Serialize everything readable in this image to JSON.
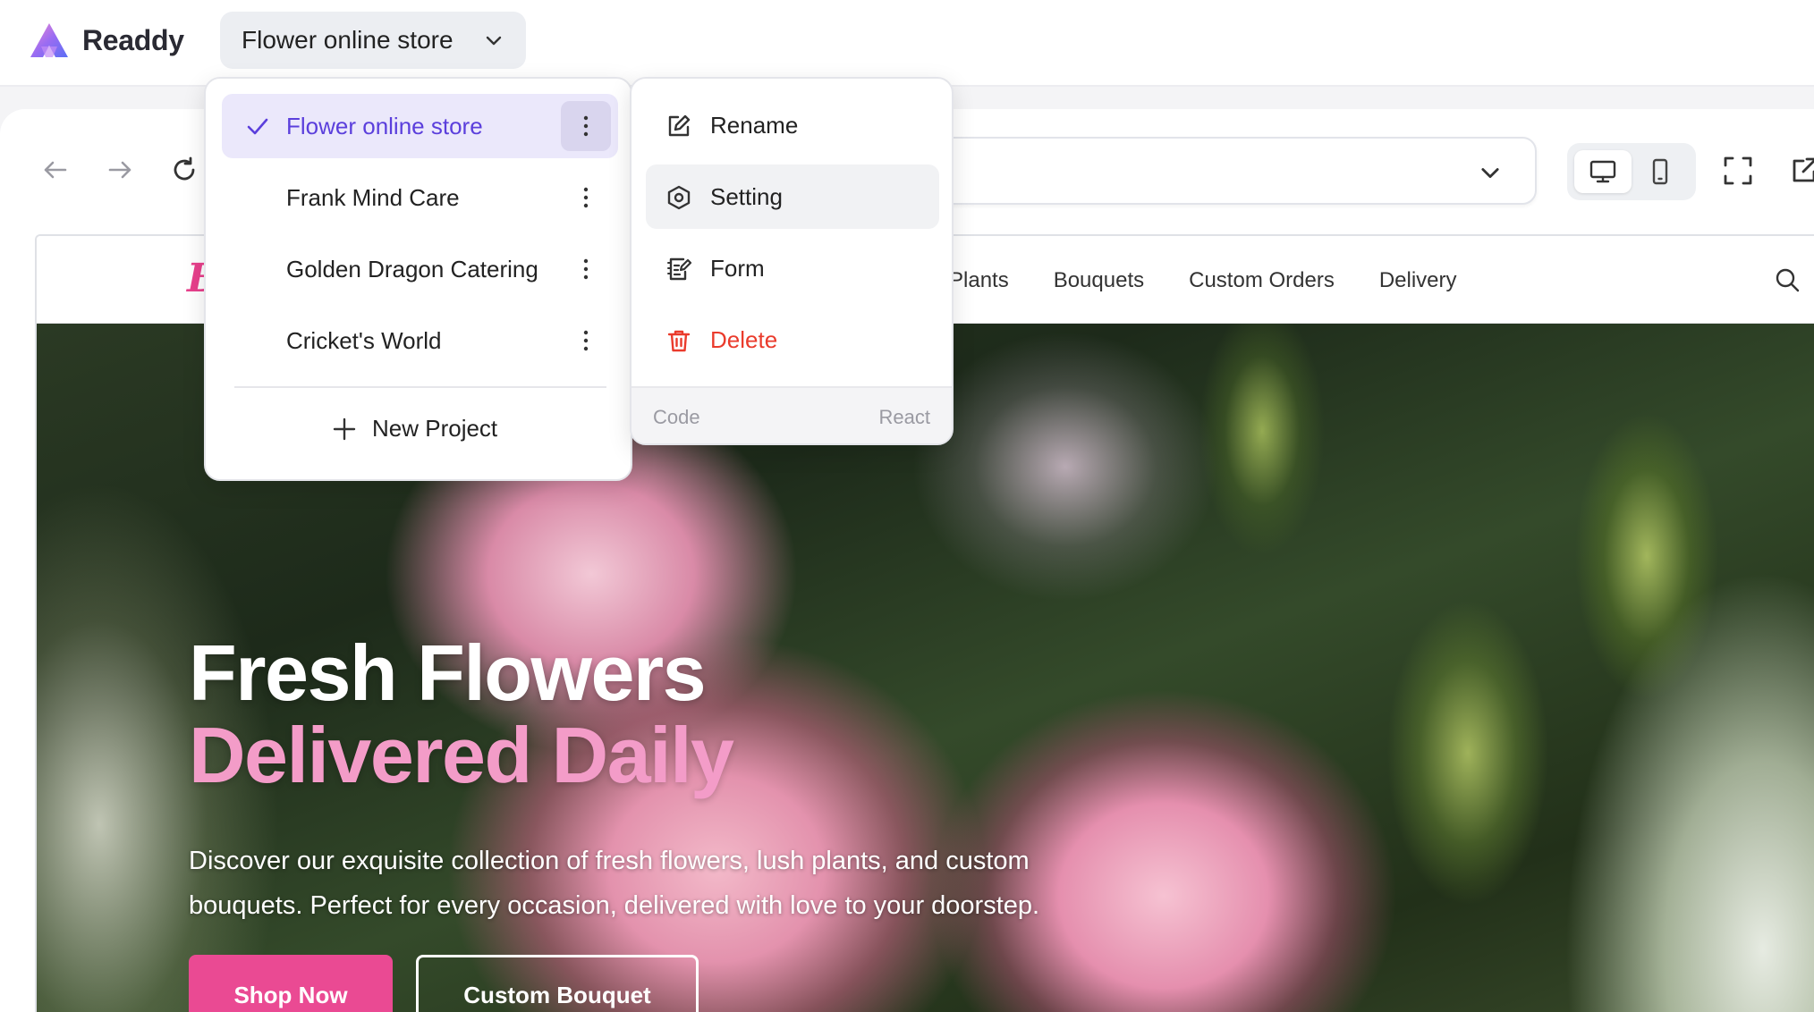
{
  "app": {
    "name": "Readdy",
    "current_project": "Flower online store"
  },
  "toolbar": {
    "back": "arrow-left-icon",
    "forward": "arrow-right-icon",
    "reload": "refresh-icon",
    "url_value": "",
    "device_desktop": "monitor-icon",
    "device_mobile": "phone-icon",
    "fullscreen": "fullscreen-icon",
    "open_external": "external-link-icon",
    "accent": "#5b3fdc"
  },
  "project_menu": {
    "items": [
      {
        "label": "Flower online store",
        "active": true
      },
      {
        "label": "Frank Mind Care",
        "active": false
      },
      {
        "label": "Golden Dragon Catering",
        "active": false
      },
      {
        "label": "Cricket's World",
        "active": false
      }
    ],
    "new_project_label": "New Project"
  },
  "context_menu": {
    "items": [
      {
        "label": "Rename",
        "icon": "edit-icon"
      },
      {
        "label": "Setting",
        "icon": "settings-icon"
      },
      {
        "label": "Form",
        "icon": "form-icon"
      },
      {
        "label": "Delete",
        "icon": "trash-icon",
        "color": "#ea3b2c"
      }
    ],
    "footer_left": "Code",
    "footer_right": "React"
  },
  "site": {
    "logo": "B",
    "nav": [
      "Plants",
      "Bouquets",
      "Custom Orders",
      "Delivery"
    ],
    "hero": {
      "title_line1": "Fresh Flowers",
      "title_line2": "Delivered Daily",
      "description": "Discover our exquisite collection of fresh flowers, lush plants, and custom bouquets. Perfect for every occasion, delivered with love to your doorstep.",
      "primary_button": "Shop Now",
      "secondary_button": "Custom Bouquet"
    },
    "brand_color": "#ea4a93"
  }
}
